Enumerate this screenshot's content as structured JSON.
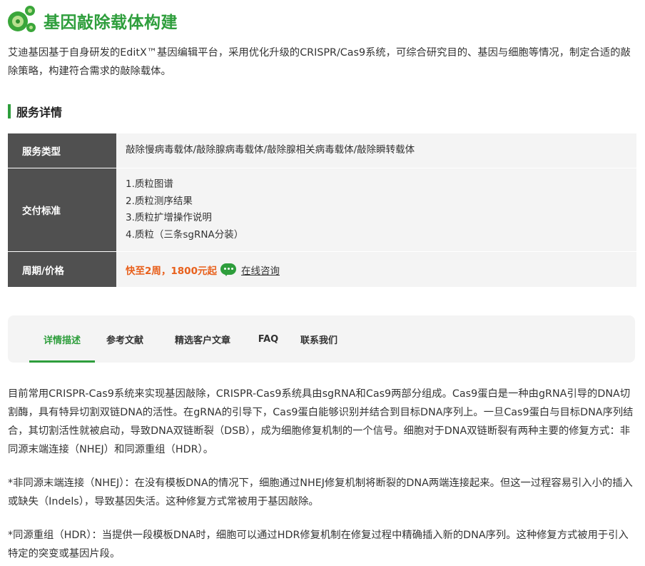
{
  "header": {
    "title": "基因敲除载体构建",
    "logo_icon": "green-cells-logo-icon"
  },
  "intro": "艾迪基因基于自身研发的EditX™基因编辑平台，采用优化升级的CRISPR/Cas9系统，可综合研究目的、基因与细胞等情况，制定合适的敲除策略，构建符合需求的敲除载体。",
  "section": {
    "title": "服务详情"
  },
  "service": {
    "type_label": "服务类型",
    "type_value": "敲除慢病毒载体/敲除腺病毒载体/敲除腺相关病毒载体/敲除瞬转载体",
    "delivery_label": "交付标准",
    "delivery_items": [
      "1.质粒图谱",
      "2.质粒测序结果",
      "3.质粒扩增操作说明",
      "4.质粒（三条sgRNA分装）"
    ],
    "period_label": "周期/价格",
    "price": "快至2周，1800元起",
    "consult_label": "在线咨询"
  },
  "tabs": [
    {
      "label": "详情描述",
      "active": true
    },
    {
      "label": "参考文献",
      "active": false
    },
    {
      "label": "精选客户文章",
      "active": false
    },
    {
      "label": "FAQ",
      "active": false
    },
    {
      "label": "联系我们",
      "active": false
    }
  ],
  "content": {
    "p1": "目前常用CRISPR-Cas9系统来实现基因敲除，CRISPR-Cas9系统具由sgRNA和Cas9两部分组成。Cas9蛋白是一种由gRNA引导的DNA切割酶，具有特异切割双链DNA的活性。在gRNA的引导下，Cas9蛋白能够识别并结合到目标DNA序列上。一旦Cas9蛋白与目标DNA序列结合，其切割活性就被启动，导致DNA双链断裂（DSB），成为细胞修复机制的一个信号。细胞对于DNA双链断裂有两种主要的修复方式：非同源末端连接（NHEJ）和同源重组（HDR）。",
    "p2": "*非同源末端连接（NHEJ）：在没有模板DNA的情况下，细胞通过NHEJ修复机制将断裂的DNA两端连接起来。但这一过程容易引入小的插入或缺失（Indels），导致基因失活。这种修复方式常被用于基因敲除。",
    "p3": "*同源重组（HDR）：当提供一段模板DNA时，细胞可以通过HDR修复机制在修复过程中精确插入新的DNA序列。这种修复方式被用于引入特定的突变或基因片段。"
  },
  "colors": {
    "brand_green": "#2e9e3c",
    "price_orange": "#e8601c",
    "key_cell_bg": "#505050",
    "val_cell_bg": "#f4f4f4"
  }
}
